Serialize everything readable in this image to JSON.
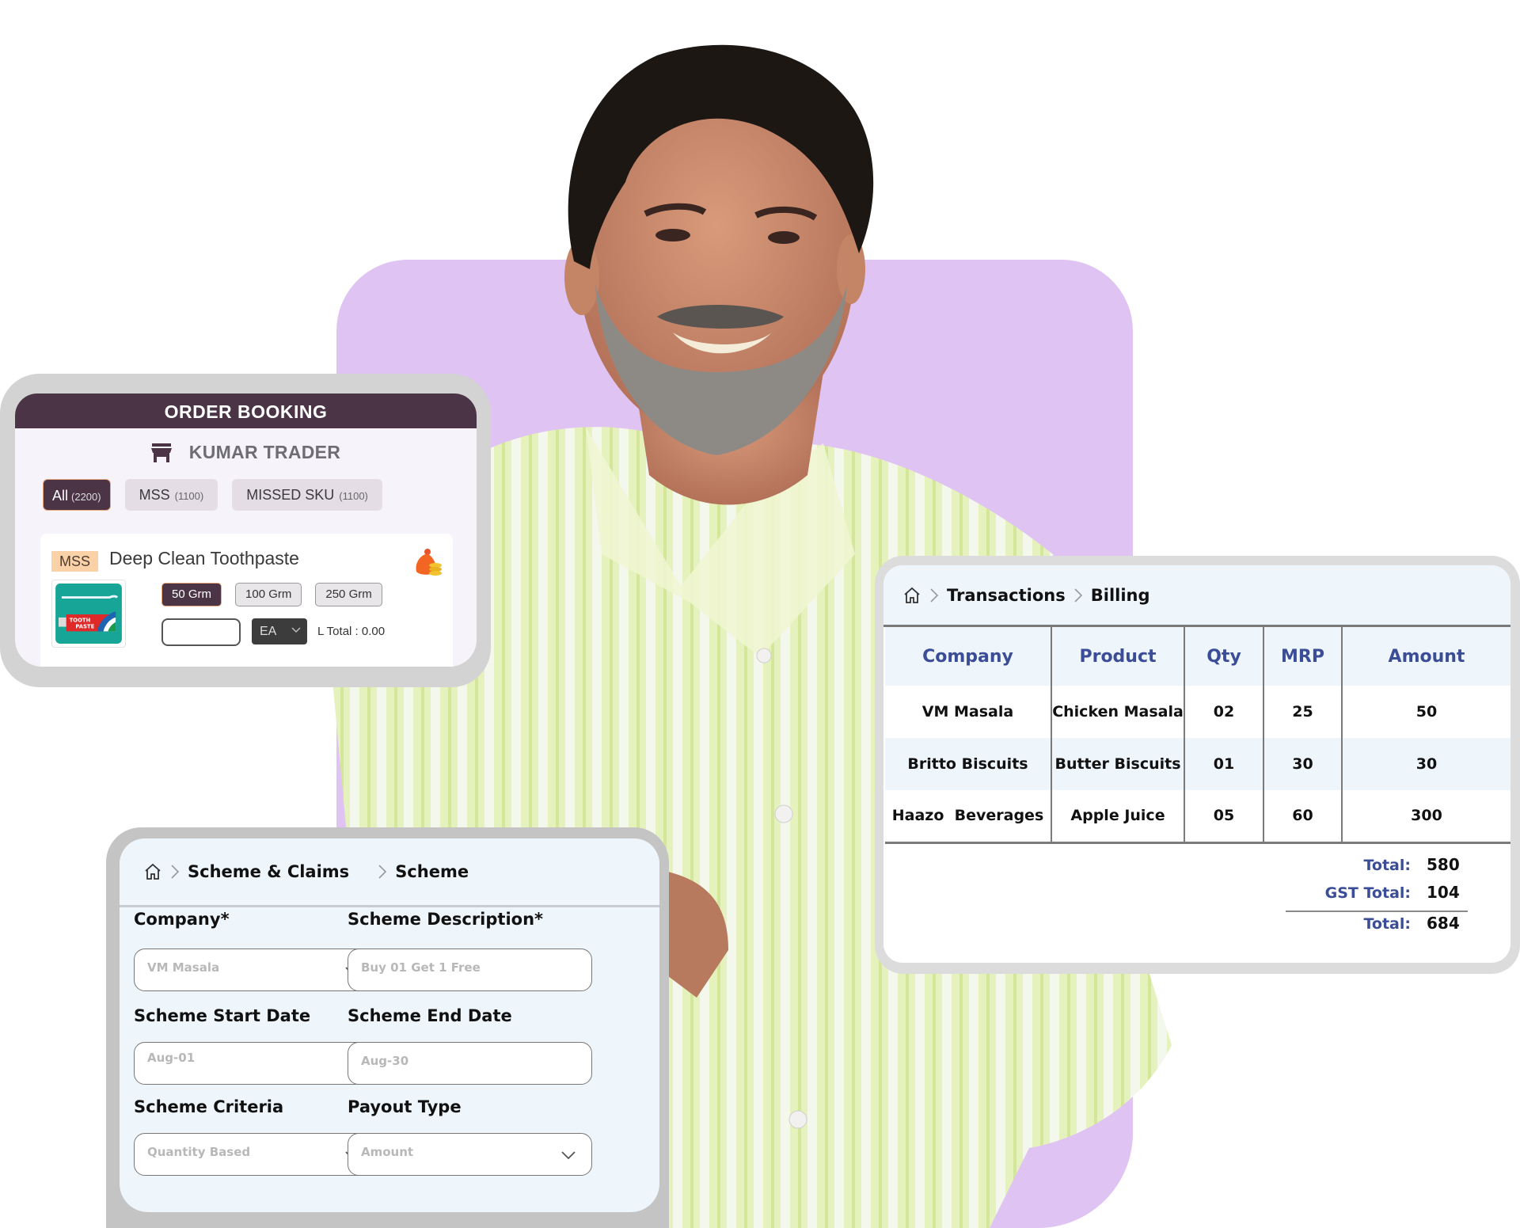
{
  "colors": {
    "backdrop_purple": "#dfc3f2",
    "order_header": "#4a3446",
    "badge_mss": "#fbd2a8",
    "table_header_text": "#3a4d96",
    "panel_tint": "#eef5fb",
    "shirt_green": "#e3f0b8"
  },
  "order_booking": {
    "title": "ORDER BOOKING",
    "store_icon": "store-icon",
    "trader_name": "KUMAR TRADER",
    "tabs": [
      {
        "label": "All",
        "count": "(2200)",
        "active": true
      },
      {
        "label": "MSS",
        "count": "(1100)",
        "active": false
      },
      {
        "label": "MISSED SKU",
        "count": "(1100)",
        "active": false
      }
    ],
    "product": {
      "badge": "MSS",
      "name": "Deep Clean Toothpaste",
      "image_label_1": "TOOTH",
      "image_label_2": "PASTE",
      "bag_icon": "money-bag-icon",
      "sizes": [
        {
          "label": "50 Grm",
          "active": true
        },
        {
          "label": "100 Grm",
          "active": false
        },
        {
          "label": "250 Grm",
          "active": false
        }
      ],
      "quantity_value": "",
      "uom": "EA",
      "line_total": "L Total : 0.00"
    }
  },
  "billing": {
    "breadcrumb": [
      "Transactions",
      "Billing"
    ],
    "columns": [
      "Company",
      "Product",
      "Qty",
      "MRP",
      "Amount"
    ],
    "rows": [
      [
        "VM Masala",
        "Chicken Masala",
        "02",
        "25",
        "50"
      ],
      [
        "Britto Biscuits",
        "Butter Biscuits",
        "01",
        "30",
        "30"
      ],
      [
        "Haazo  Beverages",
        "Apple Juice",
        "05",
        "60",
        "300"
      ]
    ],
    "totals": [
      {
        "label": "Total:",
        "value": "580"
      },
      {
        "label": "GST Total:",
        "value": "104"
      },
      {
        "label": "Total:",
        "value": "684"
      }
    ]
  },
  "scheme": {
    "breadcrumb": [
      "Scheme & Claims",
      "Scheme"
    ],
    "fields": {
      "company": {
        "label": "Company*",
        "value": "VM Masala",
        "type": "select"
      },
      "description": {
        "label": "Scheme Description*",
        "value": "Buy 01 Get 1 Free",
        "type": "text"
      },
      "start_date": {
        "label": "Scheme Start Date",
        "value": "Aug-01",
        "type": "text"
      },
      "end_date": {
        "label": "Scheme End Date",
        "value": "Aug-30",
        "type": "text"
      },
      "criteria": {
        "label": "Scheme Criteria",
        "value": "Quantity Based",
        "type": "select"
      },
      "payout": {
        "label": "Payout Type",
        "value": "Amount",
        "type": "select"
      }
    }
  }
}
